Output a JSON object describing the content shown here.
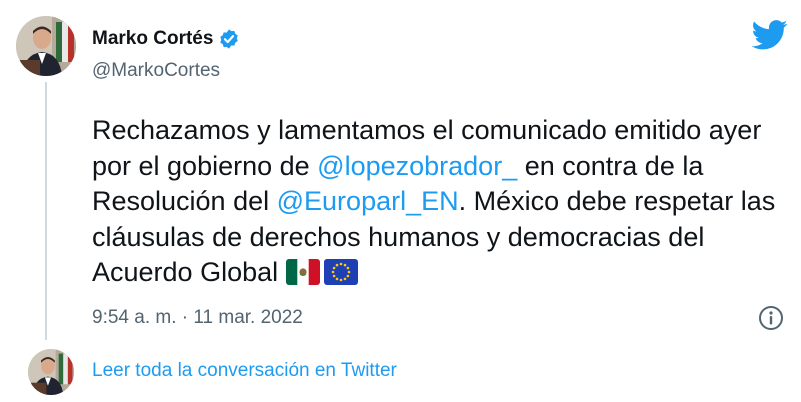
{
  "author": {
    "display_name": "Marko Cortés",
    "handle": "@MarkoCortes",
    "verified": true
  },
  "tweet": {
    "segments": [
      {
        "type": "text",
        "value": "Rechazamos y lamentamos el comunicado emitido ayer por el gobierno de "
      },
      {
        "type": "mention",
        "value": "@lopezobrador_"
      },
      {
        "type": "text",
        "value": " en contra de la Resolución del "
      },
      {
        "type": "mention",
        "value": "@Europarl_EN"
      },
      {
        "type": "text",
        "value": ". México debe respetar las cláusulas de derechos humanos y democracias del Acuerdo Global "
      }
    ],
    "emojis": [
      "mexico-flag-icon",
      "eu-flag-icon"
    ],
    "timestamp": "9:54 a. m. · 11 mar. 2022"
  },
  "footer": {
    "read_conversation": "Leer toda la conversación en Twitter"
  },
  "icons": {
    "brand": "twitter-bird-icon",
    "verified": "verified-badge-icon",
    "info": "info-icon"
  },
  "colors": {
    "link": "#1d9bf0",
    "muted": "#536471",
    "text": "#0f1419",
    "thread_line": "#cfd9de"
  }
}
